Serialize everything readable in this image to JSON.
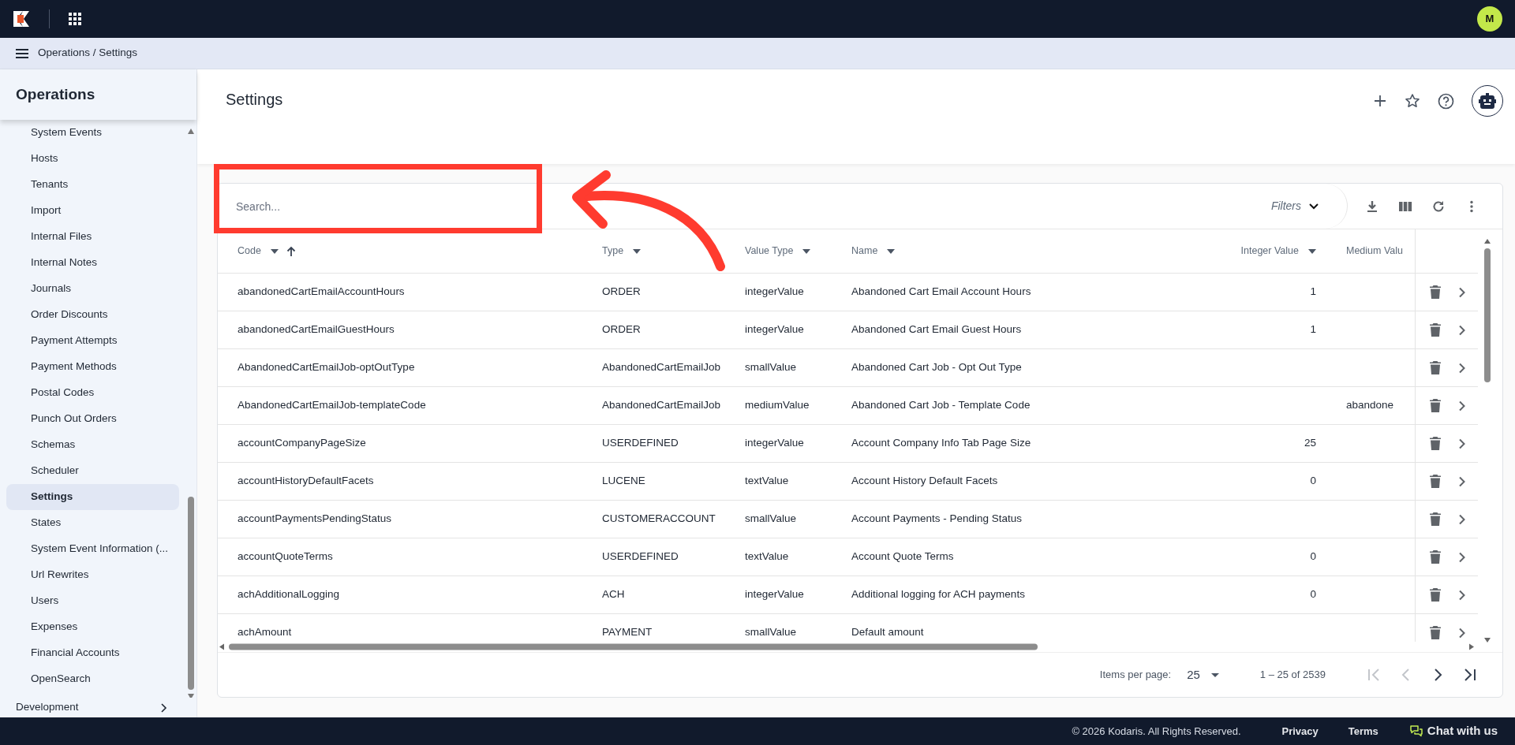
{
  "topbar": {
    "avatar": "M"
  },
  "breadcrumb": "Operations / Settings",
  "sidebar": {
    "title": "Operations",
    "items": [
      {
        "label": "System Events",
        "selected": false
      },
      {
        "label": "Hosts",
        "selected": false
      },
      {
        "label": "Tenants",
        "selected": false
      },
      {
        "label": "Import",
        "selected": false
      },
      {
        "label": "Internal Files",
        "selected": false
      },
      {
        "label": "Internal Notes",
        "selected": false
      },
      {
        "label": "Journals",
        "selected": false
      },
      {
        "label": "Order Discounts",
        "selected": false
      },
      {
        "label": "Payment Attempts",
        "selected": false
      },
      {
        "label": "Payment Methods",
        "selected": false
      },
      {
        "label": "Postal Codes",
        "selected": false
      },
      {
        "label": "Punch Out Orders",
        "selected": false
      },
      {
        "label": "Schemas",
        "selected": false
      },
      {
        "label": "Scheduler",
        "selected": false
      },
      {
        "label": "Settings",
        "selected": true
      },
      {
        "label": "States",
        "selected": false
      },
      {
        "label": "System Event Information (...",
        "selected": false
      },
      {
        "label": "Url Rewrites",
        "selected": false
      },
      {
        "label": "Users",
        "selected": false
      },
      {
        "label": "Expenses",
        "selected": false
      },
      {
        "label": "Financial Accounts",
        "selected": false
      },
      {
        "label": "OpenSearch",
        "selected": false
      }
    ],
    "section": {
      "label": "Development",
      "expanded": false
    }
  },
  "page": {
    "title": "Settings"
  },
  "table": {
    "search": {
      "placeholder": "Search..."
    },
    "filters": "Filters",
    "columns": [
      {
        "label": "Code",
        "kind": "text",
        "caret": true,
        "sorted": true
      },
      {
        "label": "Type",
        "kind": "text",
        "caret": true,
        "sorted": false
      },
      {
        "label": "Value Type",
        "kind": "text",
        "caret": true,
        "sorted": false
      },
      {
        "label": "Name",
        "kind": "text",
        "caret": true,
        "sorted": false
      },
      {
        "label": "Integer Value",
        "kind": "number",
        "caret": true,
        "sorted": false
      },
      {
        "label": "Medium Valu",
        "kind": "text",
        "caret": false,
        "sorted": false
      }
    ],
    "rows": [
      [
        "abandonedCartEmailAccountHours",
        "ORDER",
        "integerValue",
        "Abandoned Cart Email Account Hours",
        "1",
        null
      ],
      [
        "abandonedCartEmailGuestHours",
        "ORDER",
        "integerValue",
        "Abandoned Cart Email Guest Hours",
        "1",
        null
      ],
      [
        "AbandonedCartEmailJob-optOutType",
        "AbandonedCartEmailJob",
        "smallValue",
        "Abandoned Cart Job - Opt Out Type",
        null,
        null
      ],
      [
        "AbandonedCartEmailJob-templateCode",
        "AbandonedCartEmailJob",
        "mediumValue",
        "Abandoned Cart Job - Template Code",
        null,
        "abandone"
      ],
      [
        "accountCompanyPageSize",
        "USERDEFINED",
        "integerValue",
        "Account Company Info Tab Page Size",
        "25",
        null
      ],
      [
        "accountHistoryDefaultFacets",
        "LUCENE",
        "textValue",
        "Account History Default Facets",
        "0",
        null
      ],
      [
        "accountPaymentsPendingStatus",
        "CUSTOMERACCOUNT",
        "smallValue",
        "Account Payments - Pending Status",
        null,
        null
      ],
      [
        "accountQuoteTerms",
        "USERDEFINED",
        "textValue",
        "Account Quote Terms",
        "0",
        null
      ],
      [
        "achAdditionalLogging",
        "ACH",
        "integerValue",
        "Additional logging for ACH payments",
        "0",
        null
      ],
      [
        "achAmount",
        "PAYMENT",
        "smallValue",
        "Default amount",
        null,
        null
      ]
    ]
  },
  "paginator": {
    "label": "Items per page:",
    "page_size": "25",
    "range": "1 – 25 of 2539",
    "buttons": [
      {
        "kind": "first",
        "disabled": true
      },
      {
        "kind": "prev",
        "disabled": true
      },
      {
        "kind": "next",
        "disabled": false
      },
      {
        "kind": "last",
        "disabled": false
      }
    ]
  },
  "footer": {
    "copyright": "© 2026 Kodaris. All Rights Reserved.",
    "links": [
      "Privacy",
      "Terms"
    ],
    "chat": "Chat with us"
  },
  "annotation": {
    "kind": "box-with-arrow"
  }
}
